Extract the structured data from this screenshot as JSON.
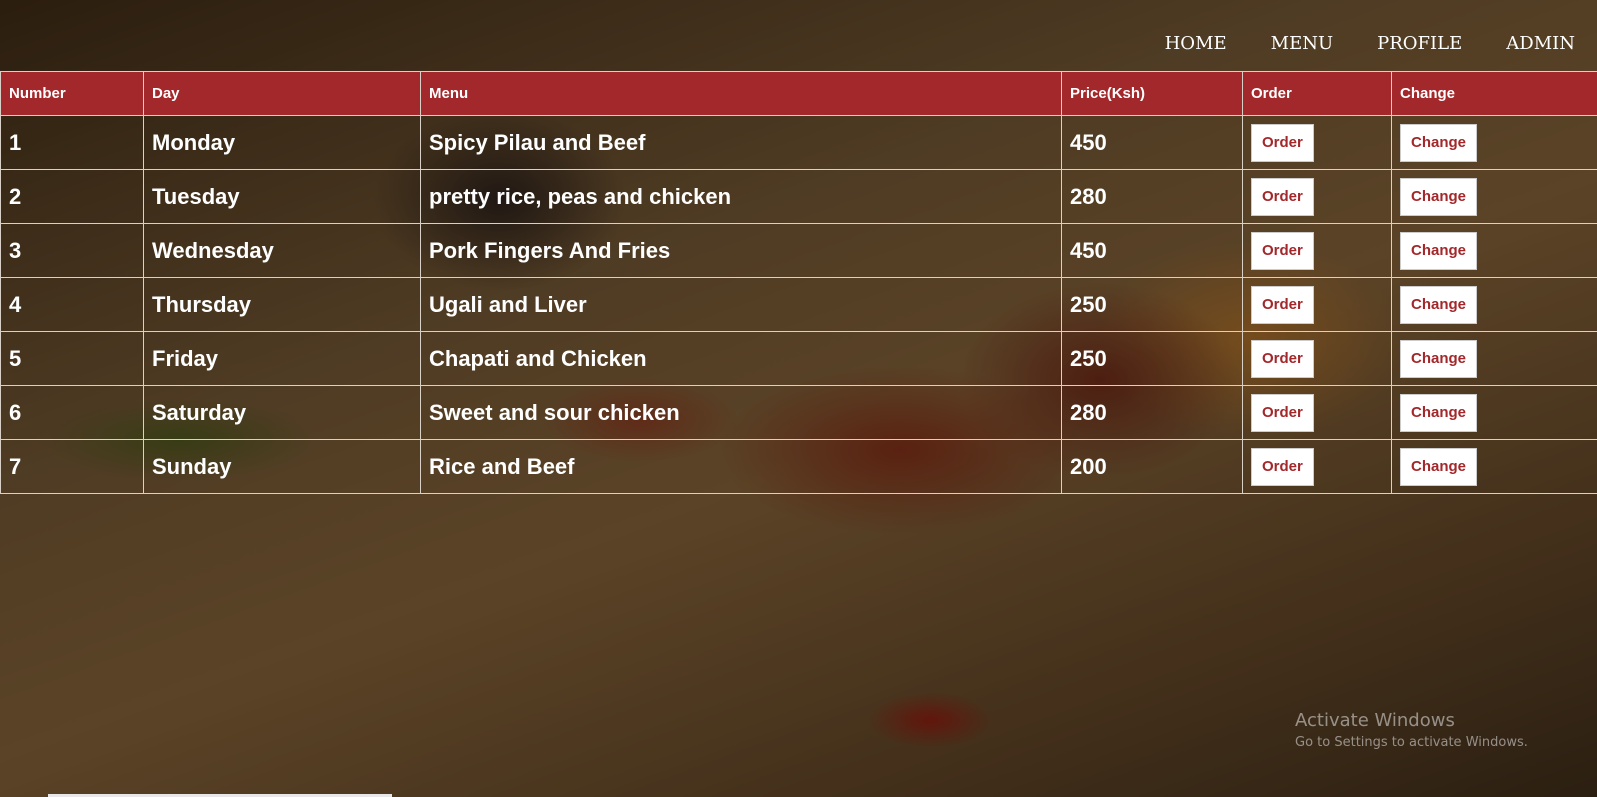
{
  "nav": {
    "items": [
      {
        "label": "HOME"
      },
      {
        "label": "MENU"
      },
      {
        "label": "PROFILE"
      },
      {
        "label": "ADMIN"
      }
    ]
  },
  "table": {
    "headers": [
      "Number",
      "Day",
      "Menu",
      "Price(Ksh)",
      "Order",
      "Change"
    ],
    "rows": [
      {
        "number": "1",
        "day": "Monday",
        "menu": "Spicy Pilau and Beef",
        "price": "450",
        "order": "Order",
        "change": "Change"
      },
      {
        "number": "2",
        "day": "Tuesday",
        "menu": "pretty rice, peas and chicken",
        "price": "280",
        "order": "Order",
        "change": "Change"
      },
      {
        "number": "3",
        "day": "Wednesday",
        "menu": "Pork Fingers And Fries",
        "price": "450",
        "order": "Order",
        "change": "Change"
      },
      {
        "number": "4",
        "day": "Thursday",
        "menu": "Ugali and Liver",
        "price": "250",
        "order": "Order",
        "change": "Change"
      },
      {
        "number": "5",
        "day": "Friday",
        "menu": "Chapati and Chicken",
        "price": "250",
        "order": "Order",
        "change": "Change"
      },
      {
        "number": "6",
        "day": "Saturday",
        "menu": "Sweet and sour chicken",
        "price": "280",
        "order": "Order",
        "change": "Change"
      },
      {
        "number": "7",
        "day": "Sunday",
        "menu": "Rice and Beef",
        "price": "200",
        "order": "Order",
        "change": "Change"
      }
    ]
  },
  "watermark": {
    "title": "Activate Windows",
    "subtitle": "Go to Settings to activate Windows."
  },
  "colors": {
    "header_bg": "#a3282b",
    "button_text": "#a3282b",
    "button_bg": "#ffffff"
  }
}
